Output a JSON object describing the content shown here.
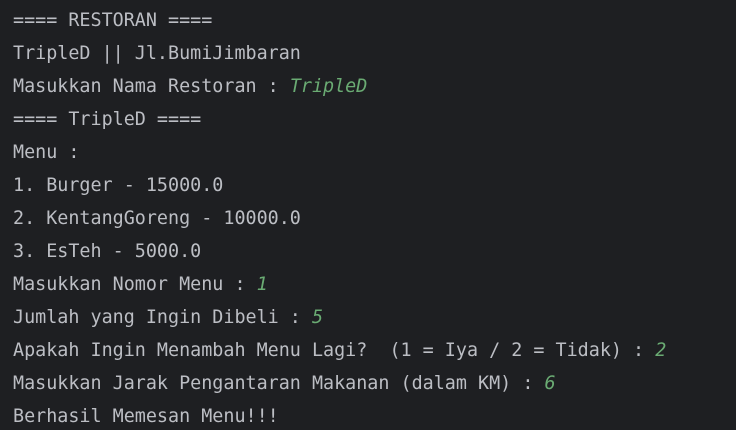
{
  "console": {
    "lines": [
      {
        "prompt": "==== RESTORAN ====",
        "input": ""
      },
      {
        "prompt": "TripleD || Jl.BumiJimbaran",
        "input": ""
      },
      {
        "prompt": "Masukkan Nama Restoran : ",
        "input": "TripleD"
      },
      {
        "prompt": "==== TripleD ====",
        "input": ""
      },
      {
        "prompt": "Menu :",
        "input": ""
      },
      {
        "prompt": "1. Burger - 15000.0",
        "input": ""
      },
      {
        "prompt": "2. KentangGoreng - 10000.0",
        "input": ""
      },
      {
        "prompt": "3. EsTeh - 5000.0",
        "input": ""
      },
      {
        "prompt": "Masukkan Nomor Menu : ",
        "input": "1"
      },
      {
        "prompt": "Jumlah yang Ingin Dibeli : ",
        "input": "5"
      },
      {
        "prompt": "Apakah Ingin Menambah Menu Lagi?  (1 = Iya / 2 = Tidak) : ",
        "input": "2"
      },
      {
        "prompt": "Masukkan Jarak Pengantaran Makanan (dalam KM) : ",
        "input": "6"
      },
      {
        "prompt": "Berhasil Memesan Menu!!!",
        "input": ""
      }
    ]
  },
  "colors": {
    "background": "#1e1f22",
    "output_text": "#bcbec4",
    "user_input": "#6aab73"
  }
}
